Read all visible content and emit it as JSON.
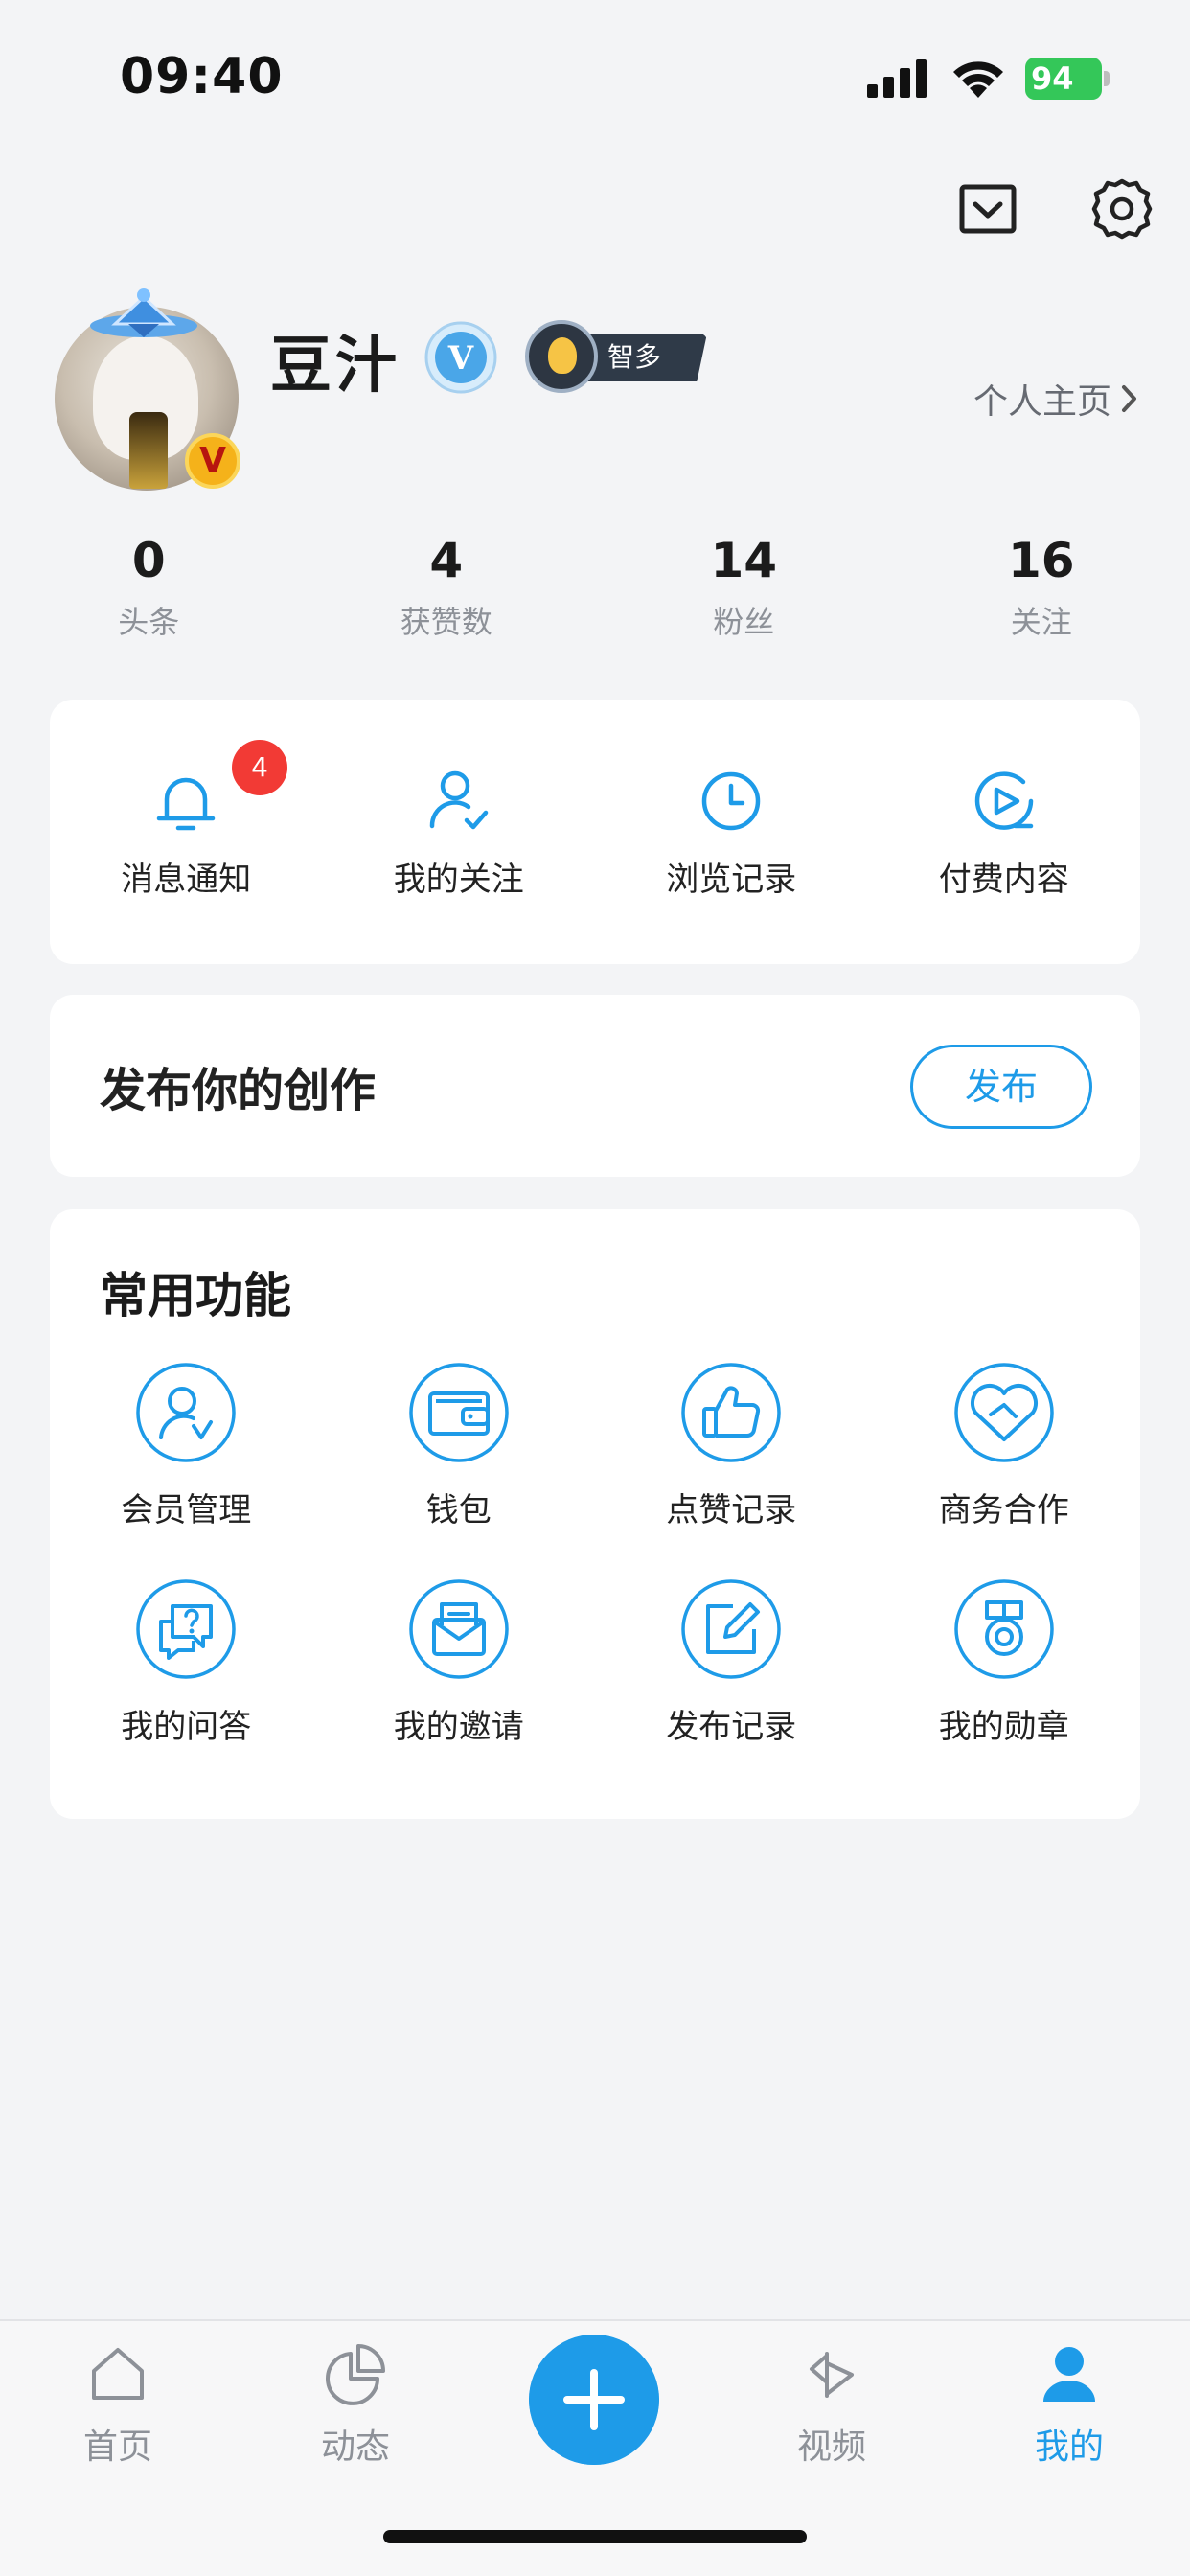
{
  "status_bar": {
    "time": "09:40",
    "battery": "94"
  },
  "profile": {
    "username": "豆汁",
    "level_title": "智多星",
    "vip_letter": "V",
    "homepage_link": "个人主页"
  },
  "stats": [
    {
      "value": "0",
      "label": "头条"
    },
    {
      "value": "4",
      "label": "获赞数"
    },
    {
      "value": "14",
      "label": "粉丝"
    },
    {
      "value": "16",
      "label": "关注"
    }
  ],
  "quick_actions": [
    {
      "label": "消息通知",
      "icon": "bell-icon",
      "badge": "4"
    },
    {
      "label": "我的关注",
      "icon": "user-check-icon"
    },
    {
      "label": "浏览记录",
      "icon": "clock-icon"
    },
    {
      "label": "付费内容",
      "icon": "play-circle-icon"
    }
  ],
  "publish": {
    "title": "发布你的创作",
    "button": "发布"
  },
  "functions": {
    "title": "常用功能",
    "items": [
      {
        "label": "会员管理",
        "icon": "member-icon"
      },
      {
        "label": "钱包",
        "icon": "wallet-icon"
      },
      {
        "label": "点赞记录",
        "icon": "thumbs-up-icon"
      },
      {
        "label": "商务合作",
        "icon": "handshake-heart-icon"
      },
      {
        "label": "我的问答",
        "icon": "qa-icon"
      },
      {
        "label": "我的邀请",
        "icon": "invite-mail-icon"
      },
      {
        "label": "发布记录",
        "icon": "edit-icon"
      },
      {
        "label": "我的勋章",
        "icon": "medal-icon"
      }
    ]
  },
  "tab_bar": {
    "tabs": [
      {
        "label": "首页",
        "icon": "home-icon"
      },
      {
        "label": "动态",
        "icon": "pie-icon"
      },
      {
        "label": "视频",
        "icon": "video-icon"
      },
      {
        "label": "我的",
        "icon": "person-icon",
        "active": true
      }
    ]
  },
  "colors": {
    "accent": "#1e9be8",
    "badge": "#f23a35",
    "background": "#f3f4f6"
  }
}
